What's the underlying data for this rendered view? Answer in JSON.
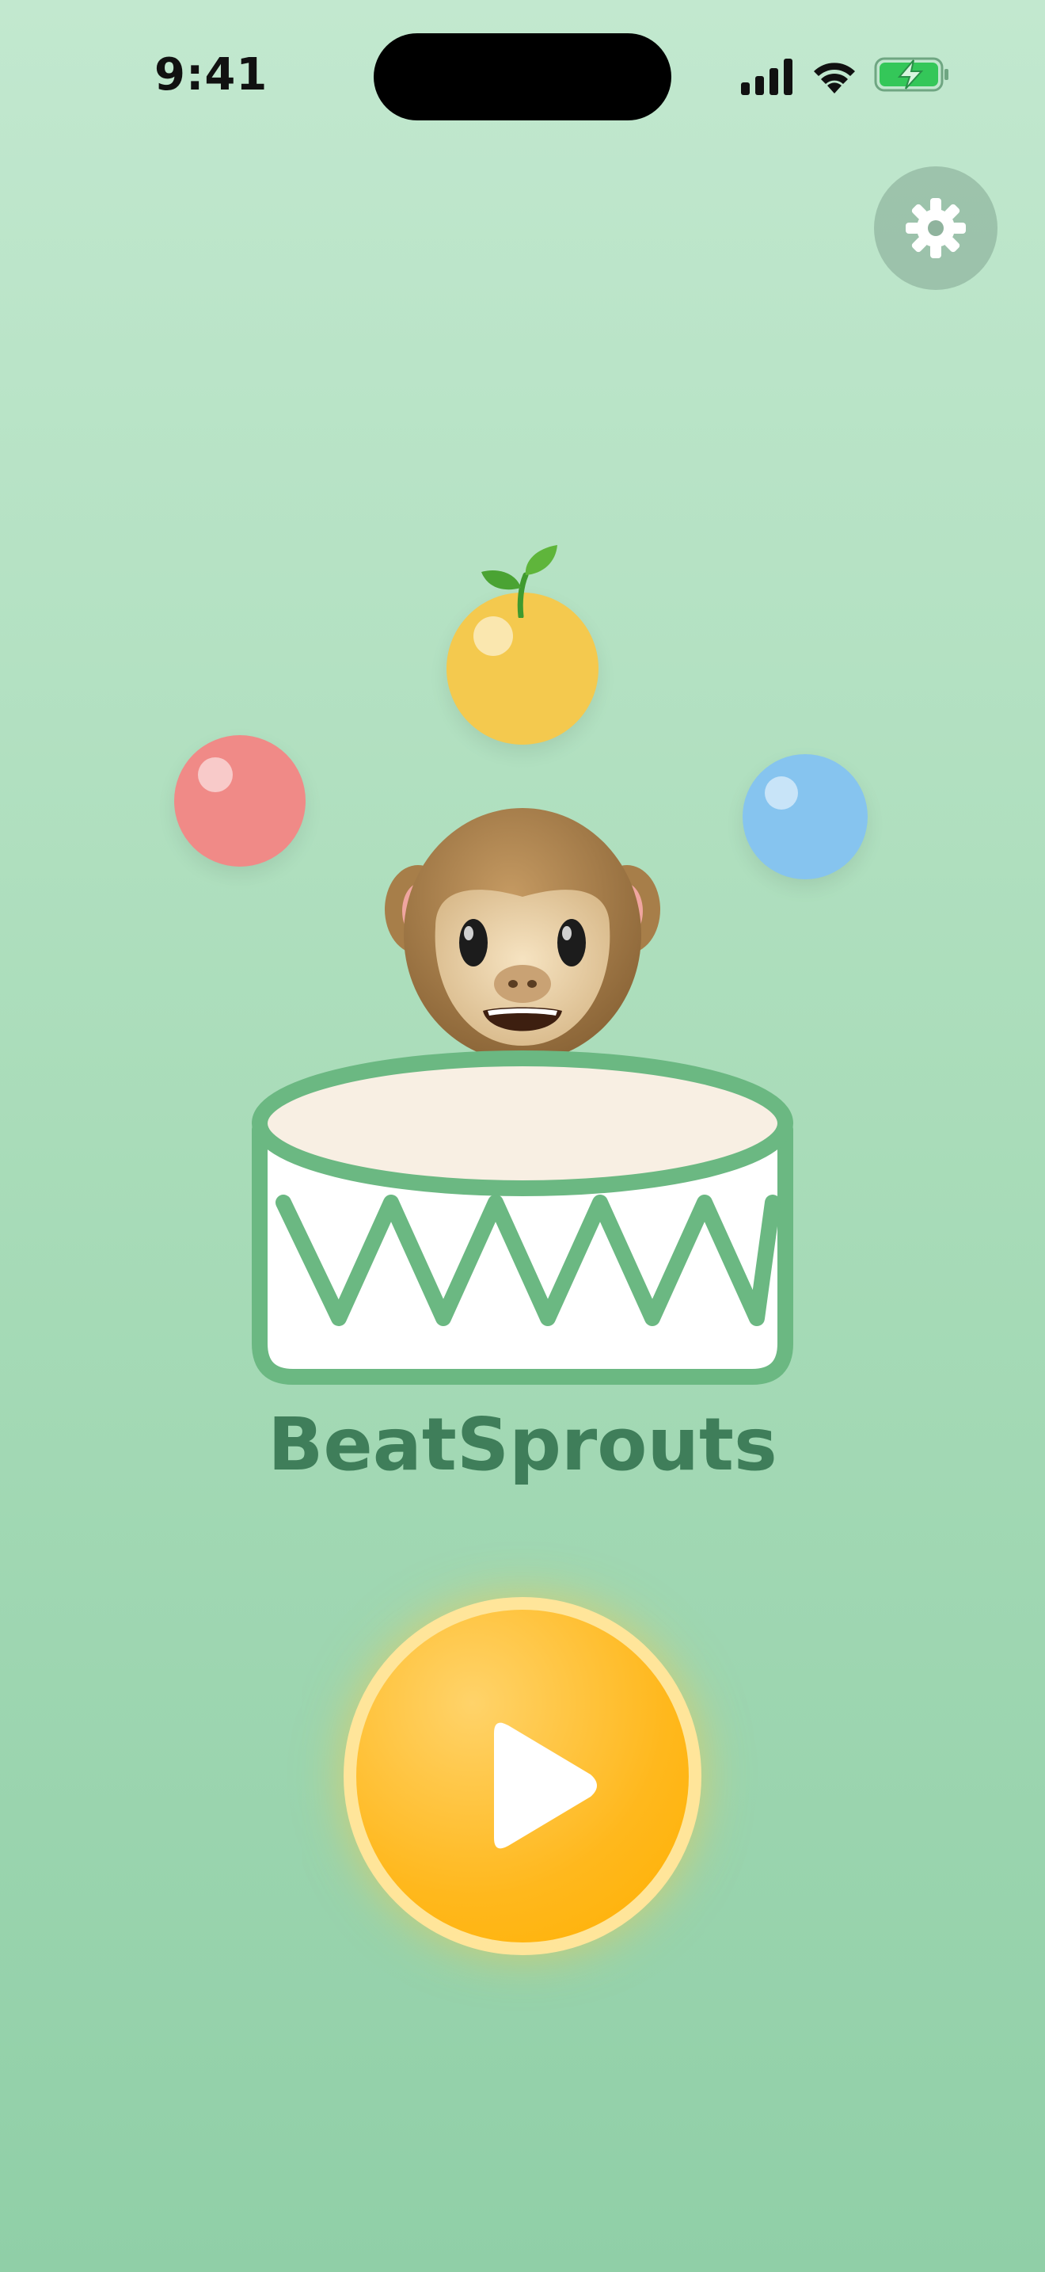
{
  "status_bar": {
    "time": "9:41"
  },
  "app": {
    "title": "BeatSprouts"
  },
  "icons": {
    "settings": "gear-icon",
    "play": "play-icon",
    "signal": "cellular-signal-icon",
    "wifi": "wifi-icon",
    "battery": "battery-charging-icon"
  },
  "colors": {
    "background_top": "#c2e8cf",
    "background_bottom": "#90cfa7",
    "title_green": "#3f7e5a",
    "drum_green": "#6bb882",
    "ball_yellow": "#f4c94e",
    "ball_red": "#f08a87",
    "ball_blue": "#86c4ef",
    "play_orange": "#ffb81d",
    "battery_green": "#34c759"
  }
}
